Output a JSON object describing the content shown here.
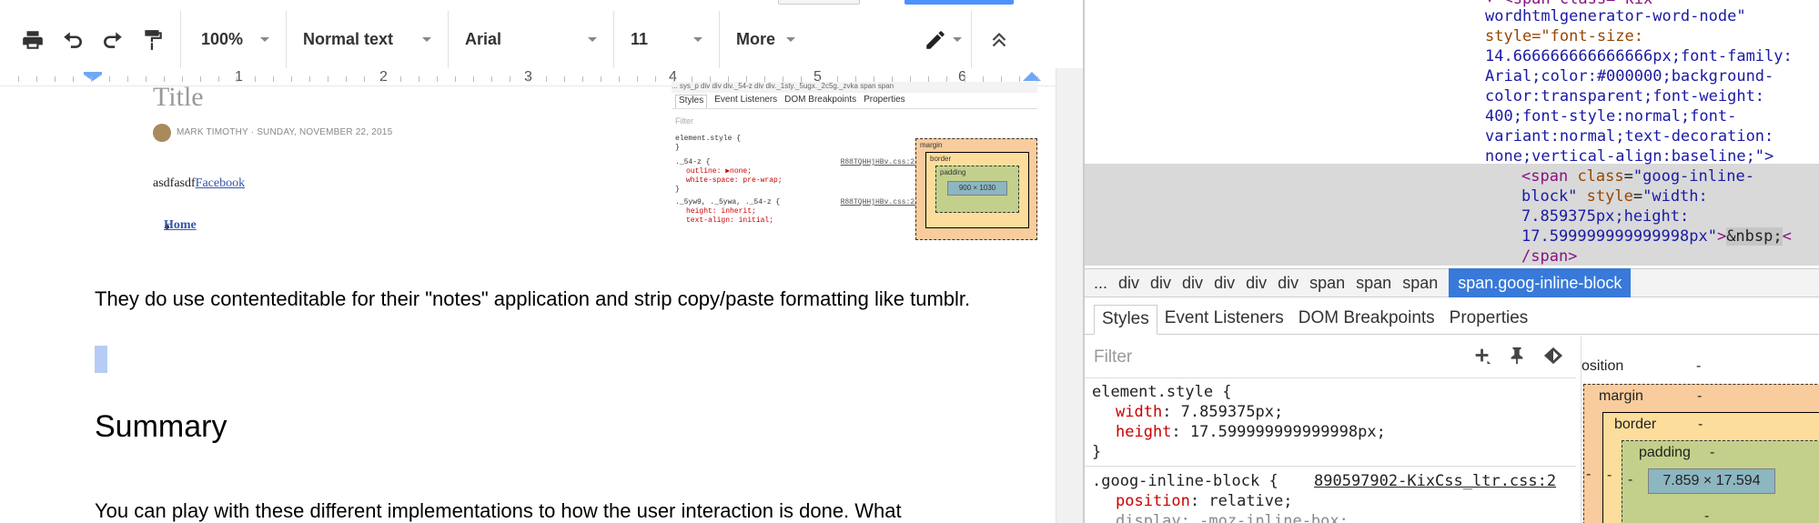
{
  "docs": {
    "toolbar": {
      "zoom": "100%",
      "style": "Normal text",
      "font": "Arial",
      "size": "11",
      "more": "More"
    },
    "ruler": {
      "numbers": [
        "1",
        "2",
        "3",
        "4",
        "5",
        "6"
      ]
    },
    "embedded": {
      "title": "Title",
      "meta": "MARK TIMOTHY · SUNDAY, NOVEMBER 22, 2015",
      "text_plain": "asdfasdf",
      "text_link": "Facebook",
      "home": "Home",
      "mini_devtools": {
        "crumbs": "...  sys_p  div  div  div._54-z  div  div._1sty._5ugx._2c5g._zvka  span  span",
        "tabs": [
          "Styles",
          "Event Listeners",
          "DOM Breakpoints",
          "Properties"
        ],
        "filter": "Filter",
        "rule1": "element.style {",
        "rule1_close": "}",
        "rule2_sel": "._54-z {",
        "rule2_src": "R88TQHHjHBv.css:25",
        "rule2_p1": "outline: ▶none;",
        "rule2_p2": "white-space: pre-wrap;",
        "rule2_close": "}",
        "rule3_sel": "._5yw9, ._5ywa, ._54-z {",
        "rule3_src": "R88TQHHjHBv.css:25",
        "rule3_p1": "height: inherit;",
        "rule3_p2": "text-align: initial;",
        "box_margin": "margin",
        "box_border": "border",
        "box_padding": "padding",
        "box_content": "900 × 1030",
        "dash": "-"
      }
    },
    "paragraph1": "They do use contenteditable for their \"notes\" application and strip copy/paste formatting like tumblr.",
    "heading": "Summary",
    "paragraph2": "You can play with these different implementations to how the user interaction is done. What"
  },
  "devtools": {
    "elements": {
      "line0": "▾ <span class=\"kix-",
      "line1": "wordhtmlgenerator-word-node\"",
      "line2": "style=\"font-size:",
      "line3": "14.666666666666666px;font-family:",
      "line4": "Arial;color:#000000;background-",
      "line5": "color:transparent;font-weight:",
      "line6": "400;font-style:normal;font-",
      "line7": "variant:normal;text-decoration:",
      "line8": "none;vertical-align:baseline;\">",
      "sel_tag_open": "<span",
      "sel_attr_class": "class",
      "sel_class_val": "\"goog-inline-",
      "sel_class_val2": "block\"",
      "sel_attr_style": "style",
      "sel_style_val": "\"width:",
      "sel_style_val2": "7.859375px;height:",
      "sel_style_val3": "17.599999999999998px\"",
      "sel_gt": ">",
      "sel_nbsp": "&nbsp;",
      "sel_lt": "<",
      "sel_close": "/span>"
    },
    "crumbs": [
      "...",
      "div",
      "div",
      "div",
      "div",
      "div",
      "div",
      "span",
      "span",
      "span"
    ],
    "crumb_active": "span.goog-inline-block",
    "tabs": [
      "Styles",
      "Event Listeners",
      "DOM Breakpoints",
      "Properties"
    ],
    "filter_placeholder": "Filter",
    "filter_icons": [
      "+",
      "📌",
      "◈"
    ],
    "styles": {
      "elstyle_sel": "element.style {",
      "p_width_name": "width",
      "p_width_val": "7.859375px;",
      "p_height_name": "height",
      "p_height_val": "17.599999999999998px;",
      "elstyle_close": "}",
      "rule_sel": ".goog-inline-block {",
      "rule_src": "890597902-KixCss_ltr.css:2",
      "p_position_name": "position",
      "p_position_val": "relative;",
      "p_display_partial": "display: -moz-inline-box;"
    },
    "boxmodel": {
      "position_label": "osition",
      "margin_label": "margin",
      "border_label": "border",
      "padding_label": "padding",
      "content": "7.859 × 17.594",
      "dash": "-"
    }
  }
}
